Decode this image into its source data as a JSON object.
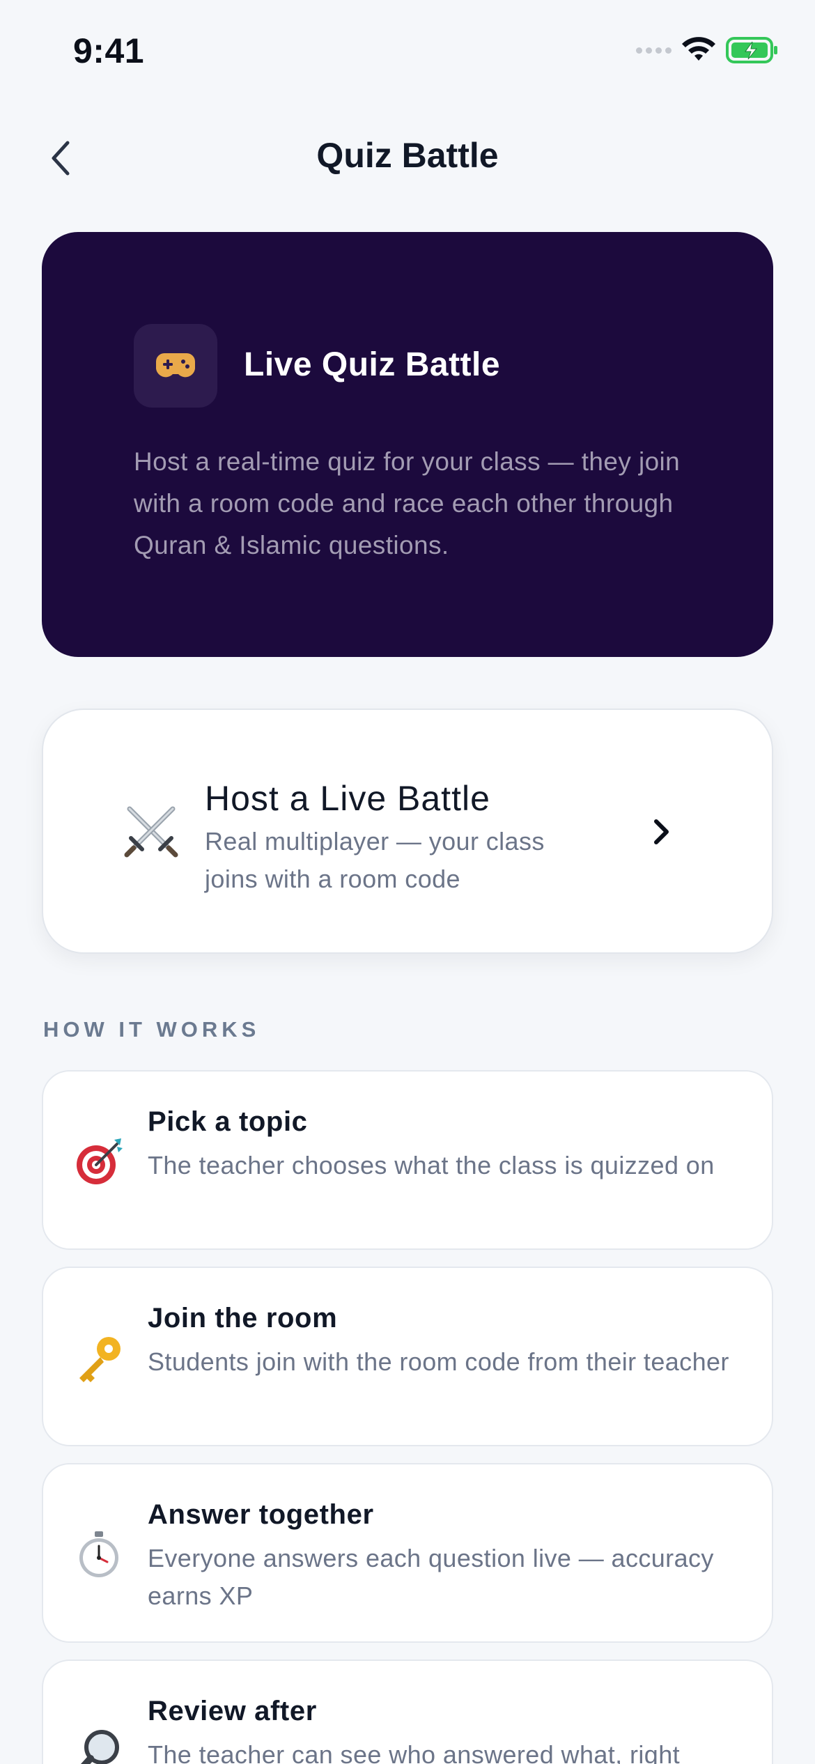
{
  "status_bar": {
    "time": "9:41"
  },
  "nav": {
    "title": "Quiz Battle",
    "back_icon": "chevron-left-icon"
  },
  "hero": {
    "icon": "gamepad-icon",
    "title": "Live Quiz Battle",
    "description": "Host a real-time quiz for your class — they join with a room code and race each other through Quran & Islamic questions."
  },
  "host_card": {
    "icon": "crossed-swords-icon",
    "title": "Host a Live Battle",
    "subtitle": "Real multiplayer — your class joins with a room code",
    "chevron": "chevron-right-icon"
  },
  "how_it_works": {
    "label": "HOW IT WORKS",
    "steps": [
      {
        "icon": "target-icon",
        "title": "Pick a topic",
        "description": "The teacher chooses what the class is quizzed on"
      },
      {
        "icon": "key-icon",
        "title": "Join the room",
        "description": "Students join with the room code from their teacher"
      },
      {
        "icon": "stopwatch-icon",
        "title": "Answer together",
        "description": "Everyone answers each question live — accuracy earns XP"
      },
      {
        "icon": "magnifier-icon",
        "title": "Review after",
        "description": "The teacher can see who answered what, right"
      }
    ]
  },
  "colors": {
    "background": "#f5f7fa",
    "hero_bg": "#1c0a3d",
    "battery": "#34c759",
    "text_primary": "#111827",
    "text_secondary": "#6b7488"
  }
}
